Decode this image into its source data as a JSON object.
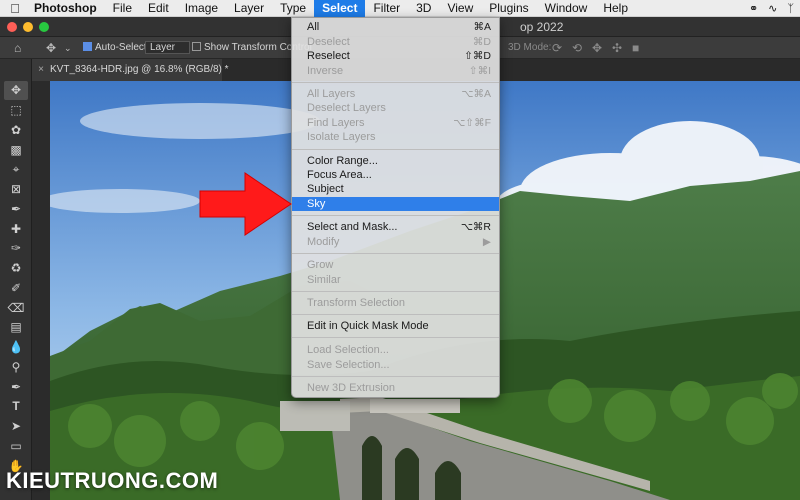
{
  "menubar": {
    "app": "Photoshop",
    "items": [
      "File",
      "Edit",
      "Image",
      "Layer",
      "Type",
      "Select",
      "Filter",
      "3D",
      "View",
      "Plugins",
      "Window",
      "Help"
    ],
    "active": "Select"
  },
  "window": {
    "title_fragment": "op 2022"
  },
  "options": {
    "auto_select_label": "Auto-Select:",
    "layer_select": "Layer",
    "show_transform_label": "Show Transform Control",
    "mode_3d_label": "3D Mode:"
  },
  "document": {
    "tab_label": "KVT_8364-HDR.jpg @ 16.8% (RGB/8) *"
  },
  "select_menu": {
    "items": [
      {
        "label": "All",
        "shortcut": "⌘A",
        "disabled": false
      },
      {
        "label": "Deselect",
        "shortcut": "⌘D",
        "disabled": true
      },
      {
        "label": "Reselect",
        "shortcut": "⇧⌘D",
        "disabled": false
      },
      {
        "label": "Inverse",
        "shortcut": "⇧⌘I",
        "disabled": true
      },
      {
        "label": "All Layers",
        "shortcut": "⌥⌘A",
        "disabled": true
      },
      {
        "label": "Deselect Layers",
        "shortcut": "",
        "disabled": true
      },
      {
        "label": "Find Layers",
        "shortcut": "⌥⇧⌘F",
        "disabled": true
      },
      {
        "label": "Isolate Layers",
        "shortcut": "",
        "disabled": true
      },
      {
        "label": "Color Range...",
        "shortcut": "",
        "disabled": false
      },
      {
        "label": "Focus Area...",
        "shortcut": "",
        "disabled": false
      },
      {
        "label": "Subject",
        "shortcut": "",
        "disabled": false
      },
      {
        "label": "Sky",
        "shortcut": "",
        "disabled": false,
        "highlighted": true
      },
      {
        "label": "Select and Mask...",
        "shortcut": "⌥⌘R",
        "disabled": false
      },
      {
        "label": "Modify",
        "shortcut": "▶",
        "disabled": true
      },
      {
        "label": "Grow",
        "shortcut": "",
        "disabled": true
      },
      {
        "label": "Similar",
        "shortcut": "",
        "disabled": true
      },
      {
        "label": "Transform Selection",
        "shortcut": "",
        "disabled": true
      },
      {
        "label": "Edit in Quick Mask Mode",
        "shortcut": "",
        "disabled": false
      },
      {
        "label": "Load Selection...",
        "shortcut": "",
        "disabled": true
      },
      {
        "label": "Save Selection...",
        "shortcut": "",
        "disabled": true
      },
      {
        "label": "New 3D Extrusion",
        "shortcut": "",
        "disabled": true
      }
    ]
  },
  "tools": [
    "move-tool",
    "marquee-tool",
    "lasso-tool",
    "object-select-tool",
    "crop-tool",
    "frame-tool",
    "eyedropper-tool",
    "healing-brush-tool",
    "brush-tool",
    "clone-stamp-tool",
    "history-brush-tool",
    "eraser-tool",
    "gradient-tool",
    "blur-tool",
    "dodge-tool",
    "pen-tool",
    "type-tool",
    "path-select-tool",
    "rectangle-tool",
    "hand-tool"
  ],
  "watermark": "KIEUTRUONG.COM",
  "colors": {
    "menu_highlight": "#2f7fe9",
    "arrow": "#ff1a1a",
    "app_bg": "#323232"
  }
}
